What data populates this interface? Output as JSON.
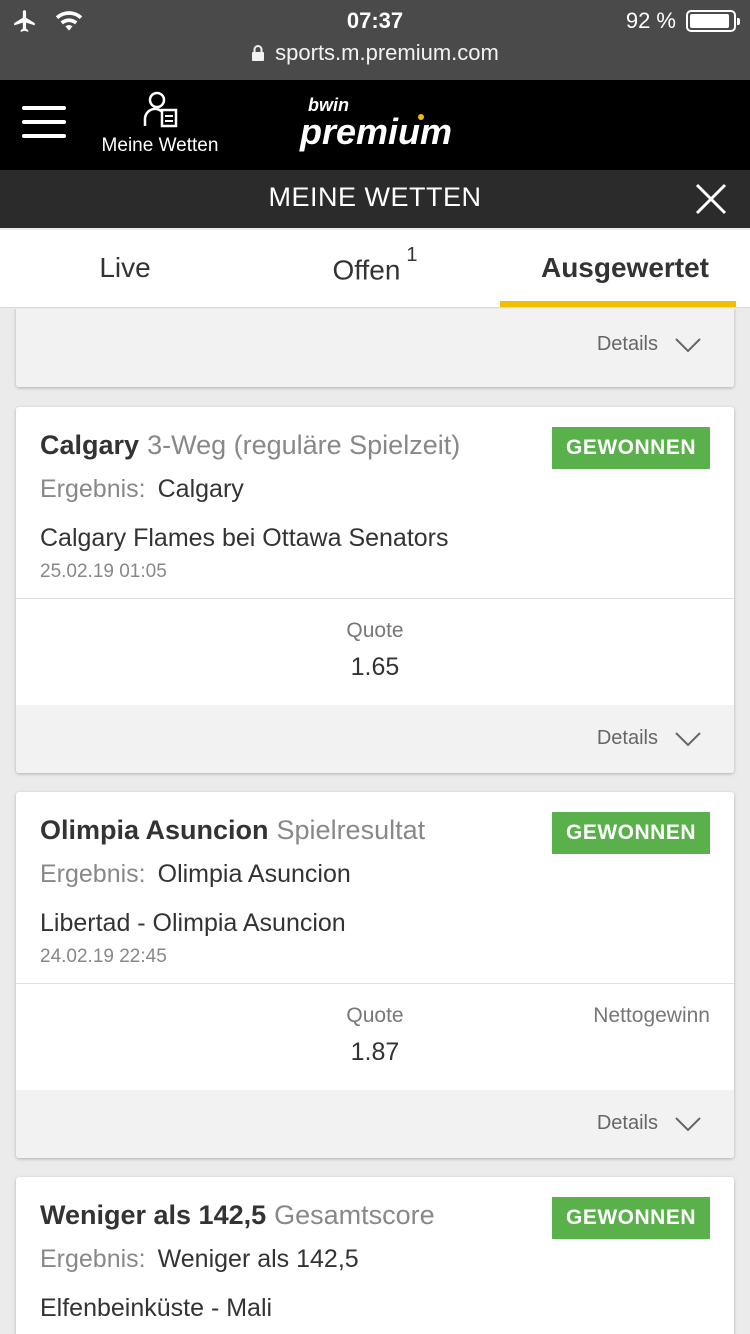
{
  "status": {
    "time": "07:37",
    "battery": "92 %",
    "battery_fraction": 0.92,
    "url": "sports.m.premium.com"
  },
  "header": {
    "my_bets_label": "Meine Wetten",
    "logo_small": "bwin",
    "logo_large": "premium"
  },
  "section": {
    "title": "MEINE WETTEN"
  },
  "tabs": [
    {
      "label": "Live",
      "badge": ""
    },
    {
      "label": "Offen",
      "badge": "1"
    },
    {
      "label": "Ausgewertet",
      "badge": ""
    }
  ],
  "details_label": "Details",
  "bets": [
    {
      "selection": "Calgary",
      "market": "3-Weg (reguläre Spielzeit)",
      "status": "GEWONNEN",
      "result_label": "Ergebnis:",
      "result": "Calgary",
      "event": "Calgary Flames bei Ottawa Senators",
      "date": "25.02.19 01:05",
      "quote_label": "Quote",
      "quote": "1.65",
      "net_label": ""
    },
    {
      "selection": "Olimpia Asuncion",
      "market": "Spielresultat",
      "status": "GEWONNEN",
      "result_label": "Ergebnis:",
      "result": "Olimpia Asuncion",
      "event": "Libertad - Olimpia Asuncion",
      "date": "24.02.19 22:45",
      "quote_label": "Quote",
      "quote": "1.87",
      "net_label": "Nettogewinn"
    },
    {
      "selection": "Weniger als 142,5",
      "market": "Gesamtscore",
      "status": "GEWONNEN",
      "result_label": "Ergebnis:",
      "result": "Weniger als 142,5",
      "event": "Elfenbeinküste - Mali"
    }
  ],
  "colors": {
    "won": "#5ab04a",
    "accent": "#f0c000",
    "header_bg": "#000000"
  }
}
